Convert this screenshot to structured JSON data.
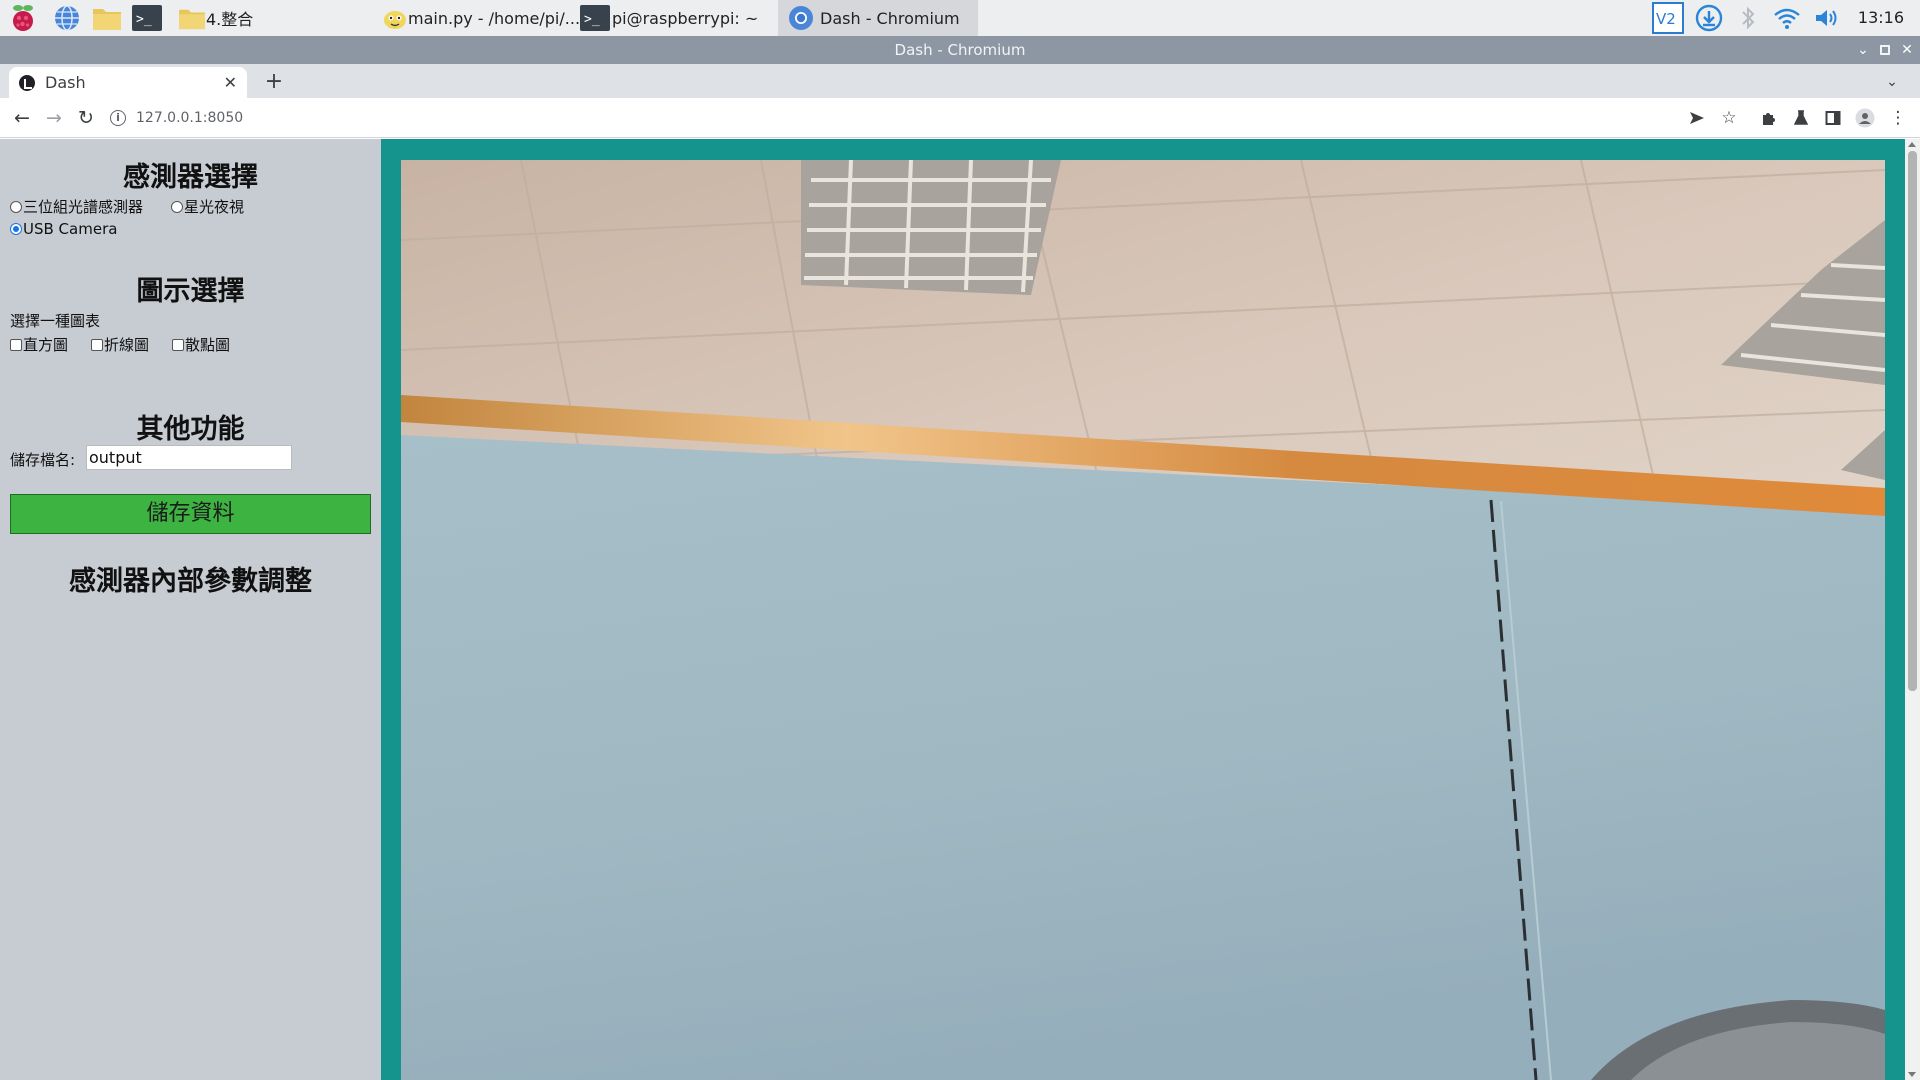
{
  "taskbar": {
    "folder_label": "4.整合",
    "tasks": [
      {
        "label": "main.py - /home/pi/..."
      },
      {
        "label": "pi@raspberrypi: ~"
      },
      {
        "label": "Dash - Chromium"
      }
    ],
    "clock": "13:16"
  },
  "window": {
    "title": "Dash - Chromium"
  },
  "browser": {
    "tab_title": "Dash",
    "url": "127.0.0.1:8050"
  },
  "sidebar": {
    "sensor_section": {
      "title": "感測器選擇",
      "options": [
        {
          "label": "三位組光譜感測器",
          "selected": false
        },
        {
          "label": "星光夜視",
          "selected": false
        },
        {
          "label": "USB Camera",
          "selected": true
        }
      ]
    },
    "chart_section": {
      "title": "圖示選擇",
      "prompt": "選擇一種圖表",
      "options": [
        {
          "label": "直方圖",
          "checked": false
        },
        {
          "label": "折線圖",
          "checked": false
        },
        {
          "label": "散點圖",
          "checked": false
        }
      ]
    },
    "other_section": {
      "title": "其他功能",
      "filename_label": "儲存檔名:",
      "filename_value": "output",
      "save_button": "儲存資料"
    },
    "params_section": {
      "title": "感測器內部參數調整"
    }
  },
  "colors": {
    "sidebar_bg": "#c7ccd3",
    "video_border": "#14948d",
    "save_button": "#3db442"
  }
}
